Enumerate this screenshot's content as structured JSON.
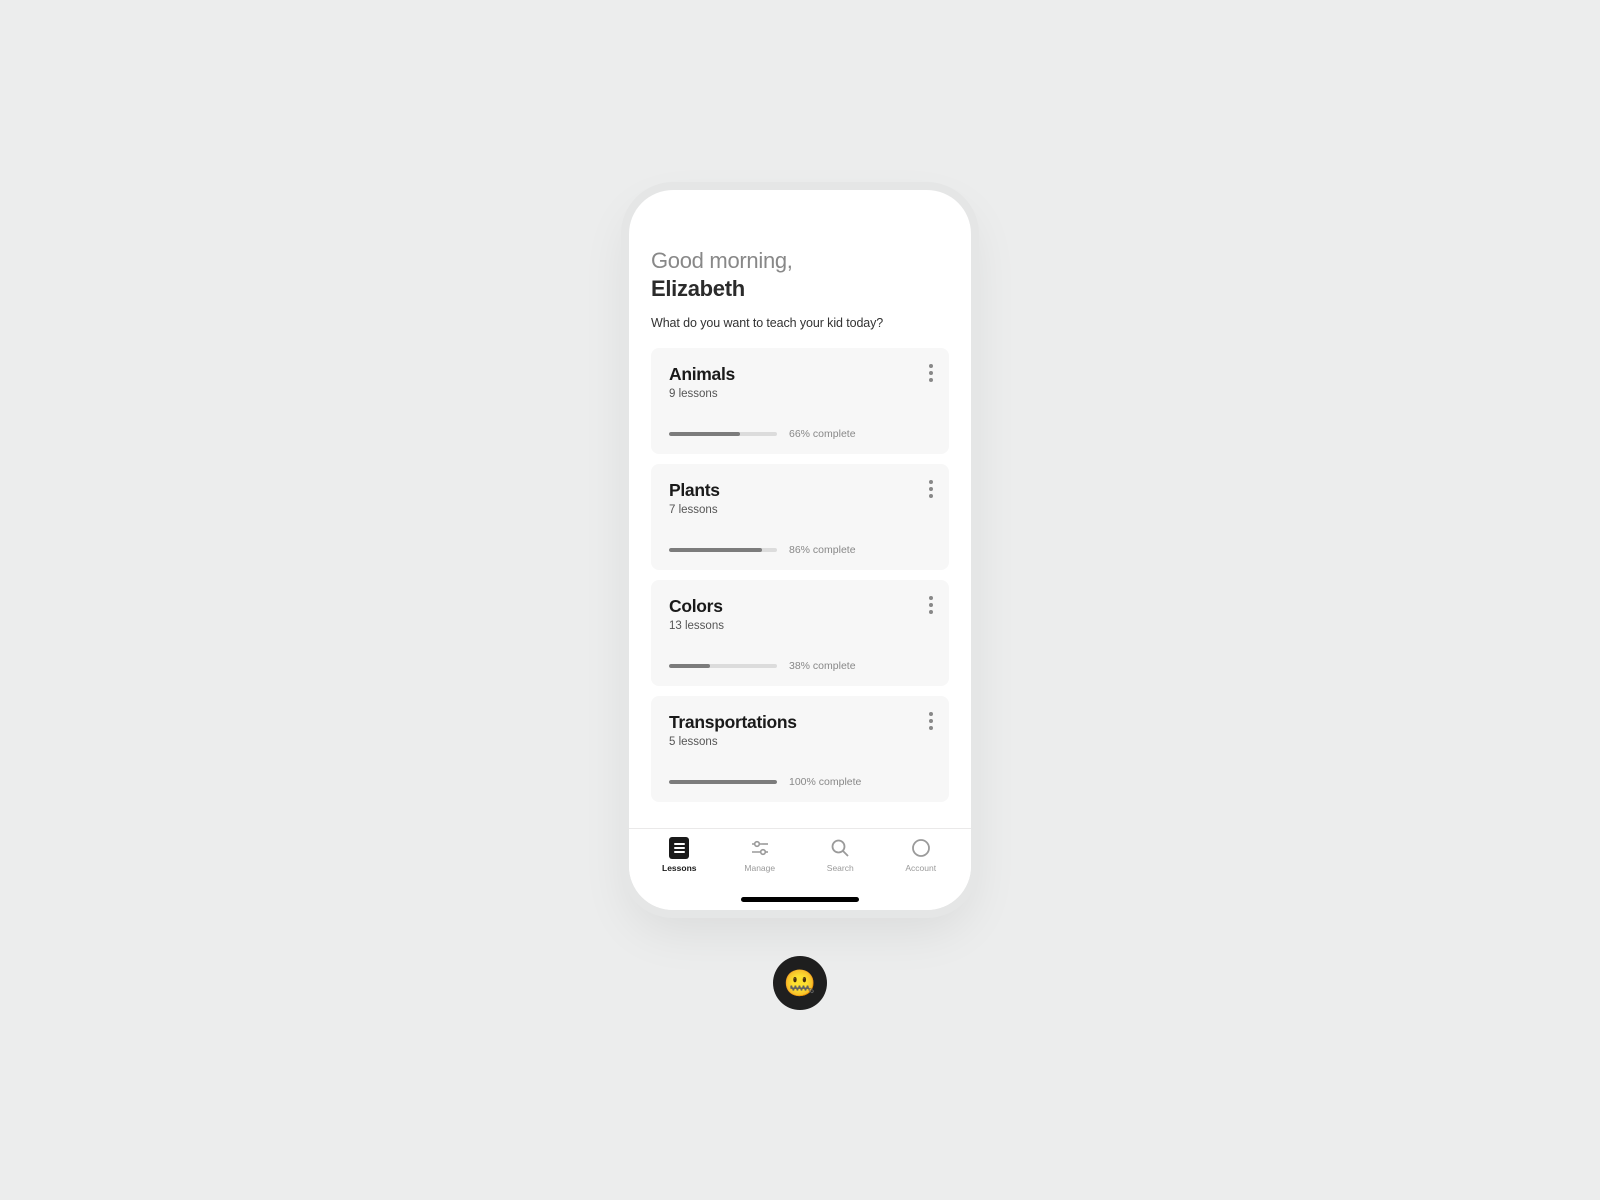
{
  "header": {
    "greeting": "Good morning,",
    "username": "Elizabeth",
    "subtitle": "What do you want to teach your kid today?"
  },
  "lessons": [
    {
      "title": "Animals",
      "sub": "9 lessons",
      "percent": 66,
      "progress_label": "66% complete"
    },
    {
      "title": "Plants",
      "sub": "7 lessons",
      "percent": 86,
      "progress_label": "86% complete"
    },
    {
      "title": "Colors",
      "sub": "13  lessons",
      "percent": 38,
      "progress_label": "38% complete"
    },
    {
      "title": "Transportations",
      "sub": "5 lessons",
      "percent": 100,
      "progress_label": "100% complete"
    }
  ],
  "tabbar": {
    "items": [
      {
        "label": "Lessons",
        "icon": "lessons-icon",
        "active": true
      },
      {
        "label": "Manage",
        "icon": "sliders-icon",
        "active": false
      },
      {
        "label": "Search",
        "icon": "search-icon",
        "active": false
      },
      {
        "label": "Account",
        "icon": "circle-icon",
        "active": false
      }
    ]
  },
  "badge_emoji": "🤐"
}
